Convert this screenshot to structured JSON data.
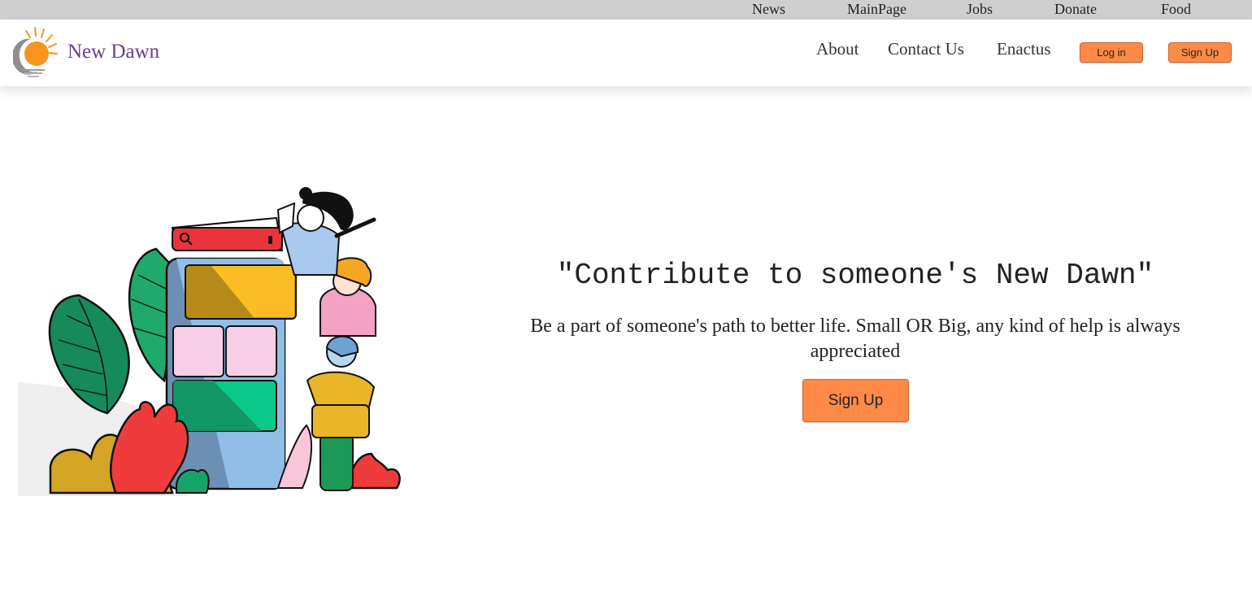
{
  "topbar": {
    "links": [
      "News",
      "MainPage",
      "Jobs",
      "Donate",
      "Food"
    ]
  },
  "header": {
    "brand": "New Dawn",
    "nav": [
      "About",
      "Contact Us",
      "Enactus"
    ],
    "login_label": "Log in",
    "signup_label": "Sign Up"
  },
  "hero": {
    "title": "\"Contribute to someone's New Dawn\"",
    "subtitle": "Be a part of someone's path to better life. Small OR Big, any kind of help is always appreciated",
    "cta_label": "Sign Up"
  },
  "colors": {
    "accent": "#ff8a47",
    "brand": "#6a3d8f",
    "topbar": "#cfcfcf"
  }
}
